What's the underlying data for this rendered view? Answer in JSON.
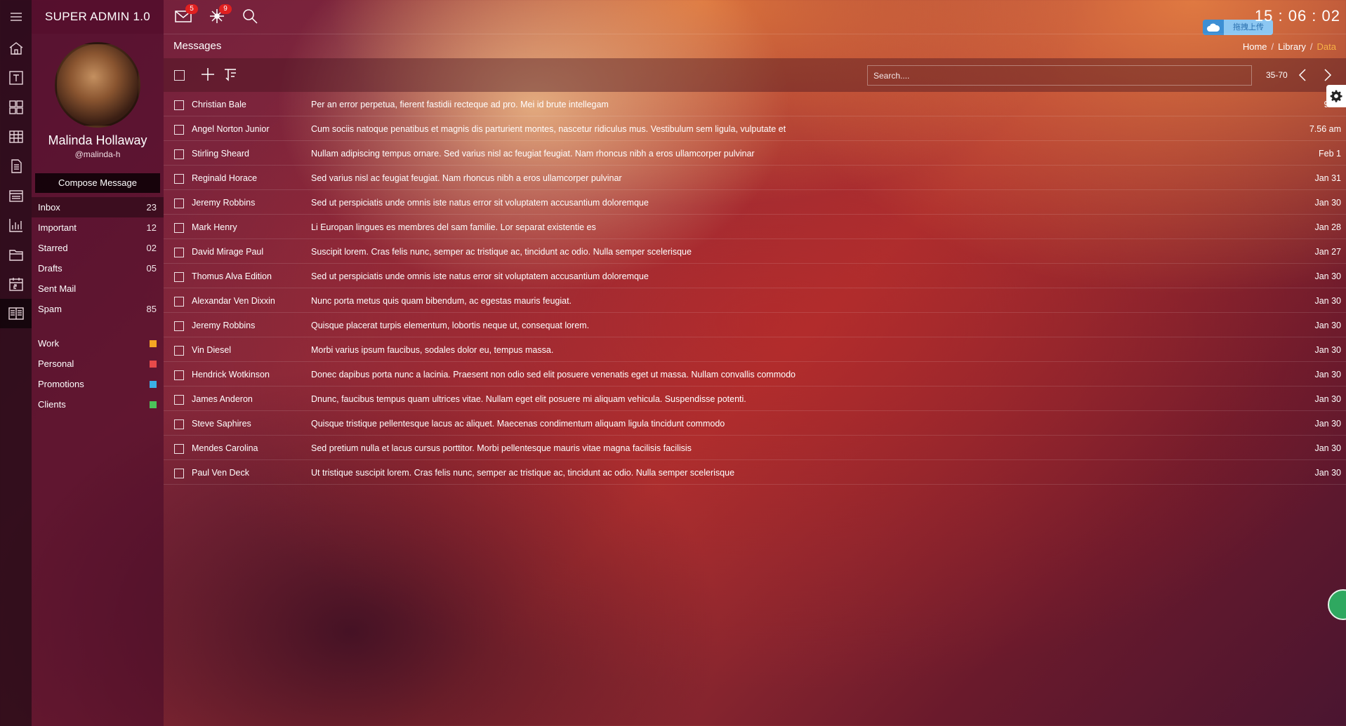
{
  "app": {
    "title": "SUPER ADMIN 1.0",
    "clock": "15 : 06 : 02",
    "upload_label": "拖拽上传"
  },
  "topbar": {
    "messages_badge": "5",
    "network_badge": "9"
  },
  "profile": {
    "name": "Malinda Hollaway",
    "handle": "@malinda-h",
    "compose_label": "Compose Message"
  },
  "mail_nav": [
    {
      "label": "Inbox",
      "count": "23"
    },
    {
      "label": "Important",
      "count": "12"
    },
    {
      "label": "Starred",
      "count": "02"
    },
    {
      "label": "Drafts",
      "count": "05"
    },
    {
      "label": "Sent Mail",
      "count": ""
    },
    {
      "label": "Spam",
      "count": "85"
    }
  ],
  "labels": [
    {
      "label": "Work",
      "color": "#f5a623"
    },
    {
      "label": "Personal",
      "color": "#e84a4a"
    },
    {
      "label": "Promotions",
      "color": "#3bb0e6"
    },
    {
      "label": "Clients",
      "color": "#4cc35a"
    }
  ],
  "page": {
    "title": "Messages",
    "breadcrumb": [
      "Home",
      "Library",
      "Data"
    ]
  },
  "toolbar": {
    "search_placeholder": "Search....",
    "paging": "35-70"
  },
  "messages": [
    {
      "from": "Christian Bale",
      "subject": "Per an error perpetua, fierent fastidii recteque ad pro. Mei id brute intellegam",
      "date": "9.46"
    },
    {
      "from": "Angel Norton Junior",
      "subject": "Cum sociis natoque penatibus et magnis dis parturient montes, nascetur ridiculus mus. Vestibulum sem ligula, vulputate et",
      "date": "7.56 am"
    },
    {
      "from": "Stirling Sheard",
      "subject": "Nullam adipiscing tempus ornare. Sed varius nisl ac feugiat feugiat. Nam rhoncus nibh a eros ullamcorper pulvinar",
      "date": "Feb 1"
    },
    {
      "from": "Reginald Horace",
      "subject": "Sed varius nisl ac feugiat feugiat. Nam rhoncus nibh a eros ullamcorper pulvinar",
      "date": "Jan 31"
    },
    {
      "from": "Jeremy Robbins",
      "subject": "Sed ut perspiciatis unde omnis iste natus error sit voluptatem accusantium doloremque",
      "date": "Jan 30"
    },
    {
      "from": "Mark Henry",
      "subject": "Li Europan lingues es membres del sam familie. Lor separat existentie es",
      "date": "Jan 28"
    },
    {
      "from": "David Mirage Paul",
      "subject": "Suscipit lorem. Cras felis nunc, semper ac tristique ac, tincidunt ac odio. Nulla semper scelerisque",
      "date": "Jan 27"
    },
    {
      "from": "Thomus Alva Edition",
      "subject": "Sed ut perspiciatis unde omnis iste natus error sit voluptatem accusantium doloremque",
      "date": "Jan 30"
    },
    {
      "from": "Alexandar Ven Dixxin",
      "subject": "Nunc porta metus quis quam bibendum, ac egestas mauris feugiat.",
      "date": "Jan 30"
    },
    {
      "from": "Jeremy Robbins",
      "subject": "Quisque placerat turpis elementum, lobortis neque ut, consequat lorem.",
      "date": "Jan 30"
    },
    {
      "from": "Vin Diesel",
      "subject": "Morbi varius ipsum faucibus, sodales dolor eu, tempus massa.",
      "date": "Jan 30"
    },
    {
      "from": "Hendrick Wotkinson",
      "subject": "Donec dapibus porta nunc a lacinia. Praesent non odio sed elit posuere venenatis eget ut massa. Nullam convallis commodo",
      "date": "Jan 30"
    },
    {
      "from": "James Anderon",
      "subject": "Dnunc, faucibus tempus quam ultrices vitae. Nullam eget elit posuere mi aliquam vehicula. Suspendisse potenti.",
      "date": "Jan 30"
    },
    {
      "from": "Steve Saphires",
      "subject": "Quisque tristique pellentesque lacus ac aliquet. Maecenas condimentum aliquam ligula tincidunt commodo",
      "date": "Jan 30"
    },
    {
      "from": "Mendes Carolina",
      "subject": "Sed pretium nulla et lacus cursus porttitor. Morbi pellentesque mauris vitae magna facilisis facilisis",
      "date": "Jan 30"
    },
    {
      "from": "Paul Ven Deck",
      "subject": "Ut tristique suscipit lorem. Cras felis nunc, semper ac tristique ac, tincidunt ac odio. Nulla semper scelerisque",
      "date": "Jan 30"
    }
  ],
  "icons": {
    "rail": [
      "menu-icon",
      "home-icon",
      "typography-icon",
      "widgets-icon",
      "table-icon",
      "document-icon",
      "form-icon",
      "chart-icon",
      "folder-icon",
      "calendar-icon",
      "mail-layout-icon"
    ],
    "topbar": [
      "envelope-icon",
      "network-icon",
      "search-icon"
    ],
    "toolbar": [
      "select-all-checkbox",
      "plus-icon",
      "filter-icon",
      "chevron-left-icon",
      "chevron-right-icon",
      "gear-icon"
    ]
  }
}
